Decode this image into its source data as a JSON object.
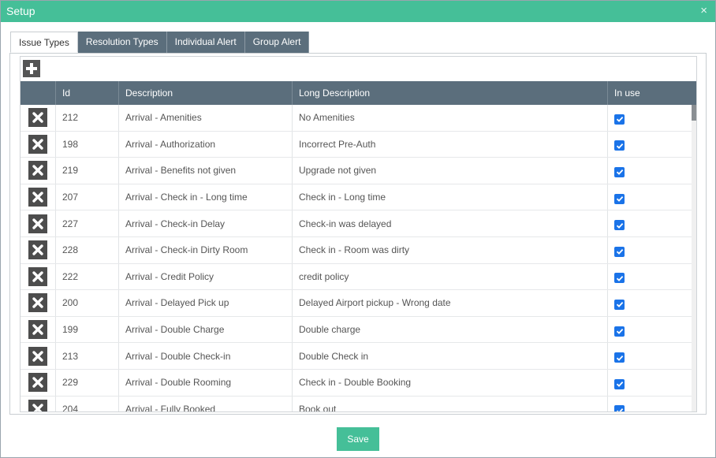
{
  "window": {
    "title": "Setup",
    "close_glyph": "×"
  },
  "tabs": [
    {
      "label": "Issue Types",
      "active": true
    },
    {
      "label": "Resolution Types",
      "active": false
    },
    {
      "label": "Individual Alert",
      "active": false
    },
    {
      "label": "Group Alert",
      "active": false
    }
  ],
  "grid": {
    "add_icon": "plus-icon",
    "delete_icon": "close-icon",
    "columns": [
      "",
      "Id",
      "Description",
      "Long Description",
      "In use"
    ],
    "rows": [
      {
        "id": "212",
        "description": "Arrival - Amenities",
        "long_description": "No Amenities",
        "in_use": true
      },
      {
        "id": "198",
        "description": "Arrival - Authorization",
        "long_description": "Incorrect Pre-Auth",
        "in_use": true
      },
      {
        "id": "219",
        "description": "Arrival - Benefits not given",
        "long_description": "Upgrade not given",
        "in_use": true
      },
      {
        "id": "207",
        "description": "Arrival - Check in - Long time",
        "long_description": "Check in - Long time",
        "in_use": true
      },
      {
        "id": "227",
        "description": "Arrival - Check-in Delay",
        "long_description": "Check-in was delayed",
        "in_use": true
      },
      {
        "id": "228",
        "description": "Arrival - Check-in Dirty Room",
        "long_description": "Check in - Room was dirty",
        "in_use": true
      },
      {
        "id": "222",
        "description": "Arrival - Credit Policy",
        "long_description": "credit policy",
        "in_use": true
      },
      {
        "id": "200",
        "description": "Arrival - Delayed Pick up",
        "long_description": "Delayed Airport pickup - Wrong date",
        "in_use": true
      },
      {
        "id": "199",
        "description": "Arrival - Double Charge",
        "long_description": "Double charge",
        "in_use": true
      },
      {
        "id": "213",
        "description": "Arrival - Double Check-in",
        "long_description": "Double Check in",
        "in_use": true
      },
      {
        "id": "229",
        "description": "Arrival - Double Rooming",
        "long_description": "Check in - Double Booking",
        "in_use": true
      },
      {
        "id": "204",
        "description": "Arrival - Fully Booked",
        "long_description": "Book out",
        "in_use": true
      }
    ]
  },
  "footer": {
    "save_label": "Save"
  },
  "colors": {
    "accent": "#45bf98",
    "header": "#5b6e7c",
    "checkbox": "#1a73e8"
  }
}
